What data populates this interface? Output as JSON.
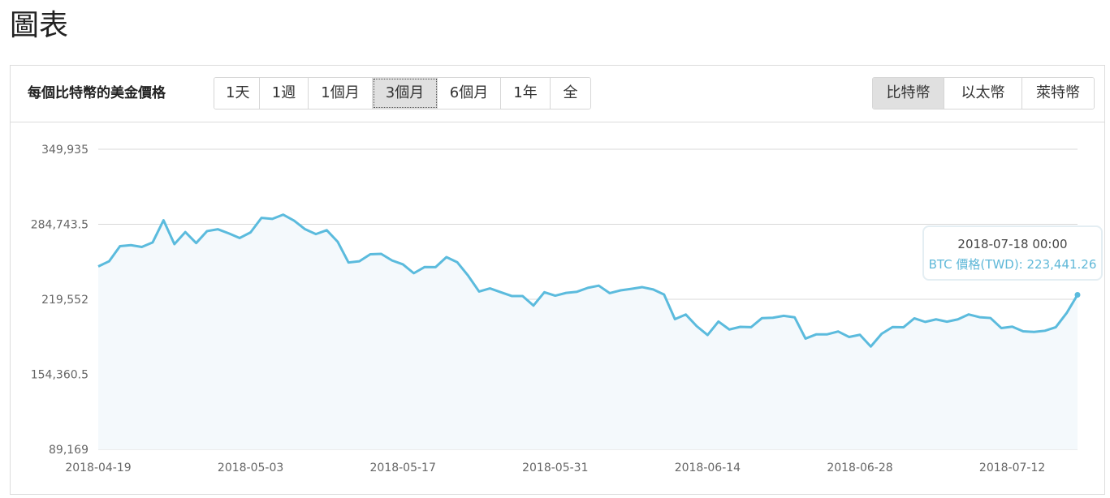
{
  "page": {
    "title": "圖表"
  },
  "panel": {
    "label": "每個比特幣的美金價格",
    "ranges": [
      "1天",
      "1週",
      "1個月",
      "3個月",
      "6個月",
      "1年",
      "全"
    ],
    "active_range": "3個月",
    "coins": [
      "比特幣",
      "以太幣",
      "萊特幣"
    ],
    "active_coin": "比特幣"
  },
  "colors": {
    "line": "#5bbbdd",
    "area": "#f4f9fc",
    "grid": "#d8d8d8",
    "active_button": "#e0e0e0"
  },
  "tooltip": {
    "date": "2018-07-18 00:00",
    "value_text": "BTC 價格(TWD): 223,441.26"
  },
  "chart_data": {
    "type": "area",
    "ylim": [
      89169,
      349935
    ],
    "y_ticks": [
      349935,
      284743.5,
      219552,
      154360.5,
      89169
    ],
    "y_tick_labels": [
      "349,935",
      "284,743.5",
      "219,552",
      "154,360.5",
      "89,169"
    ],
    "x_tick_labels": [
      "2018-04-19",
      "2018-05-03",
      "2018-05-17",
      "2018-05-31",
      "2018-06-14",
      "2018-06-28",
      "2018-07-12"
    ],
    "x_start": "2018-04-19",
    "x_end": "2018-07-18",
    "grid": true,
    "series": [
      {
        "values": [
          248100,
          252600,
          265700,
          266600,
          265000,
          269000,
          288200,
          267500,
          278000,
          268400,
          278800,
          280400,
          276800,
          272800,
          277700,
          290300,
          289400,
          293100,
          287900,
          280500,
          276200,
          279600,
          269600,
          251500,
          252600,
          258700,
          259000,
          253300,
          249900,
          242200,
          247600,
          247500,
          256200,
          251700,
          240000,
          226300,
          229000,
          225700,
          222400,
          222400,
          214100,
          225700,
          222700,
          225100,
          226100,
          229500,
          231400,
          224900,
          227300,
          228600,
          230100,
          228100,
          223700,
          202300,
          206300,
          196200,
          188500,
          200200,
          193300,
          195600,
          195300,
          203200,
          203500,
          205200,
          203900,
          185400,
          189100,
          189100,
          191600,
          186800,
          188700,
          178500,
          189600,
          195400,
          195200,
          203000,
          199900,
          202100,
          200100,
          202100,
          206400,
          204000,
          203300,
          194500,
          195800,
          191700,
          191200,
          192200,
          195300,
          207600,
          223441.26
        ]
      }
    ]
  }
}
